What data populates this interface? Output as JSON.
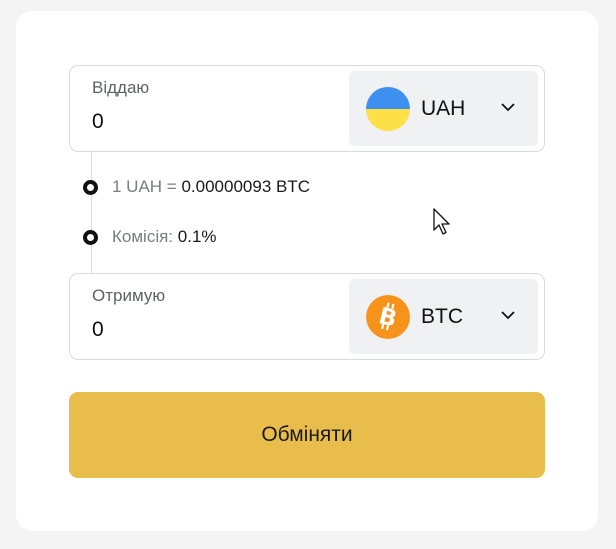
{
  "give": {
    "label": "Віддаю",
    "value": "0",
    "currency": {
      "code": "UAH",
      "icon": "ukraine-flag-icon"
    }
  },
  "info": {
    "rate_prefix": "1 UAH =",
    "rate_value": "0.00000093 BTC",
    "fee_label": "Комісія:",
    "fee_value": "0.1%"
  },
  "get": {
    "label": "Отримую",
    "value": "0",
    "currency": {
      "code": "BTC",
      "icon": "bitcoin-icon"
    }
  },
  "submit": {
    "label": "Обміняти"
  },
  "colors": {
    "accent": "#e9bd4c",
    "flag_blue": "#3d8ff0",
    "flag_yellow": "#fde047",
    "bitcoin": "#f7931a"
  }
}
